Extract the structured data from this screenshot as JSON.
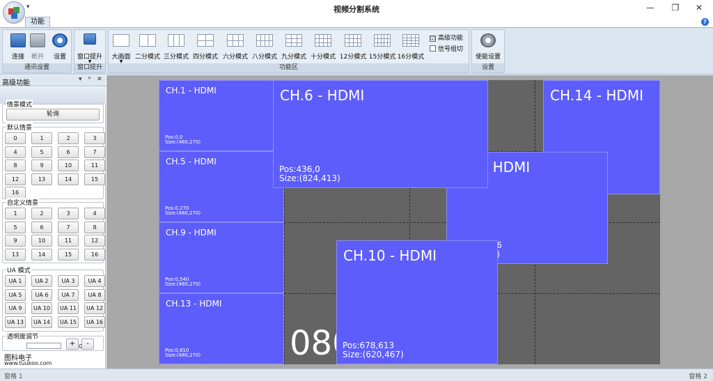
{
  "window": {
    "title": "视频分割系统",
    "qat_arrow": "▾",
    "minimize": "—",
    "restore": "❐",
    "close": "✕"
  },
  "ribbon": {
    "tab": "功能",
    "help": "?",
    "groups": {
      "comm": "通讯设置",
      "window_raise": "窗口提升",
      "function_area": "功能区",
      "settings": "设置"
    },
    "buttons": {
      "connect": "连接",
      "disconnect": "断开",
      "settings": "设置",
      "window_raise": "窗口提升",
      "big_screen": "大画面",
      "split2": "二分模式",
      "split3": "三分模式",
      "split4": "四分模式",
      "split6": "六分模式",
      "split8": "八分模式",
      "split9": "九分模式",
      "split10": "十分模式",
      "split12": "12分模式",
      "split15": "15分模式",
      "split16": "16分模式",
      "enable_settings": "使能设置"
    },
    "checks": {
      "advanced": "高级功能",
      "advanced_checked": "☑",
      "signal_group": "信号组切"
    }
  },
  "panel": {
    "title": "高级功能",
    "pin": "▾  ᵖ  ✕",
    "scene_mode": {
      "title": "情景模式",
      "poll": "轮询"
    },
    "default_scenes": {
      "title": "默认情景",
      "items": [
        "0",
        "1",
        "2",
        "3",
        "4",
        "5",
        "6",
        "7",
        "8",
        "9",
        "10",
        "11",
        "12",
        "13",
        "14",
        "15",
        "16"
      ]
    },
    "custom_scenes": {
      "title": "自定义情景",
      "items": [
        "1",
        "2",
        "3",
        "4",
        "5",
        "6",
        "7",
        "8",
        "9",
        "10",
        "11",
        "12",
        "13",
        "14",
        "15",
        "16"
      ]
    },
    "ua_mode": {
      "title": "UA 模式",
      "items": [
        "UA 1",
        "UA 2",
        "UA 3",
        "UA 4",
        "UA 5",
        "UA 6",
        "UA 7",
        "UA 8",
        "UA 9",
        "UA 10",
        "UA 11",
        "UA 12",
        "UA 13",
        "UA 14",
        "UA 15",
        "UA 16"
      ]
    },
    "transparency": {
      "title": "透明度调节",
      "value": "0",
      "plus": "+",
      "minus": "-"
    },
    "brand": "图科电子",
    "website": "www.tuukoo.com"
  },
  "status": {
    "left": "窗格 1",
    "right": "窗格 2"
  },
  "canvas": {
    "bg_number": "080",
    "windows": {
      "ch1": {
        "name": "CH.1 - HDMI",
        "pos": "Pos:0,0",
        "size": "Size:(480,270)"
      },
      "ch5": {
        "name": "CH.5 - HDMI",
        "pos": "Pos:0,270",
        "size": "Size:(480,270)"
      },
      "ch9": {
        "name": "CH.9 - HDMI",
        "pos": "Pos:0,540",
        "size": "Size:(480,270)"
      },
      "ch13": {
        "name": "CH.13 - HDMI",
        "pos": "Pos:0,810",
        "size": "Size:(480,270)"
      },
      "ch14": {
        "name": "CH.14 - HDMI",
        "pos": "",
        "size": ""
      },
      "mid": {
        "name": "- HDMI",
        "pos": "276",
        "size": "23)"
      },
      "ch6": {
        "name": "CH.6 - HDMI",
        "pos": "Pos:436,0",
        "size": "Size:(824,413)"
      },
      "ch10": {
        "name": "CH.10 - HDMI",
        "pos": "Pos:678,613",
        "size": "Size:(620,467)"
      }
    }
  }
}
